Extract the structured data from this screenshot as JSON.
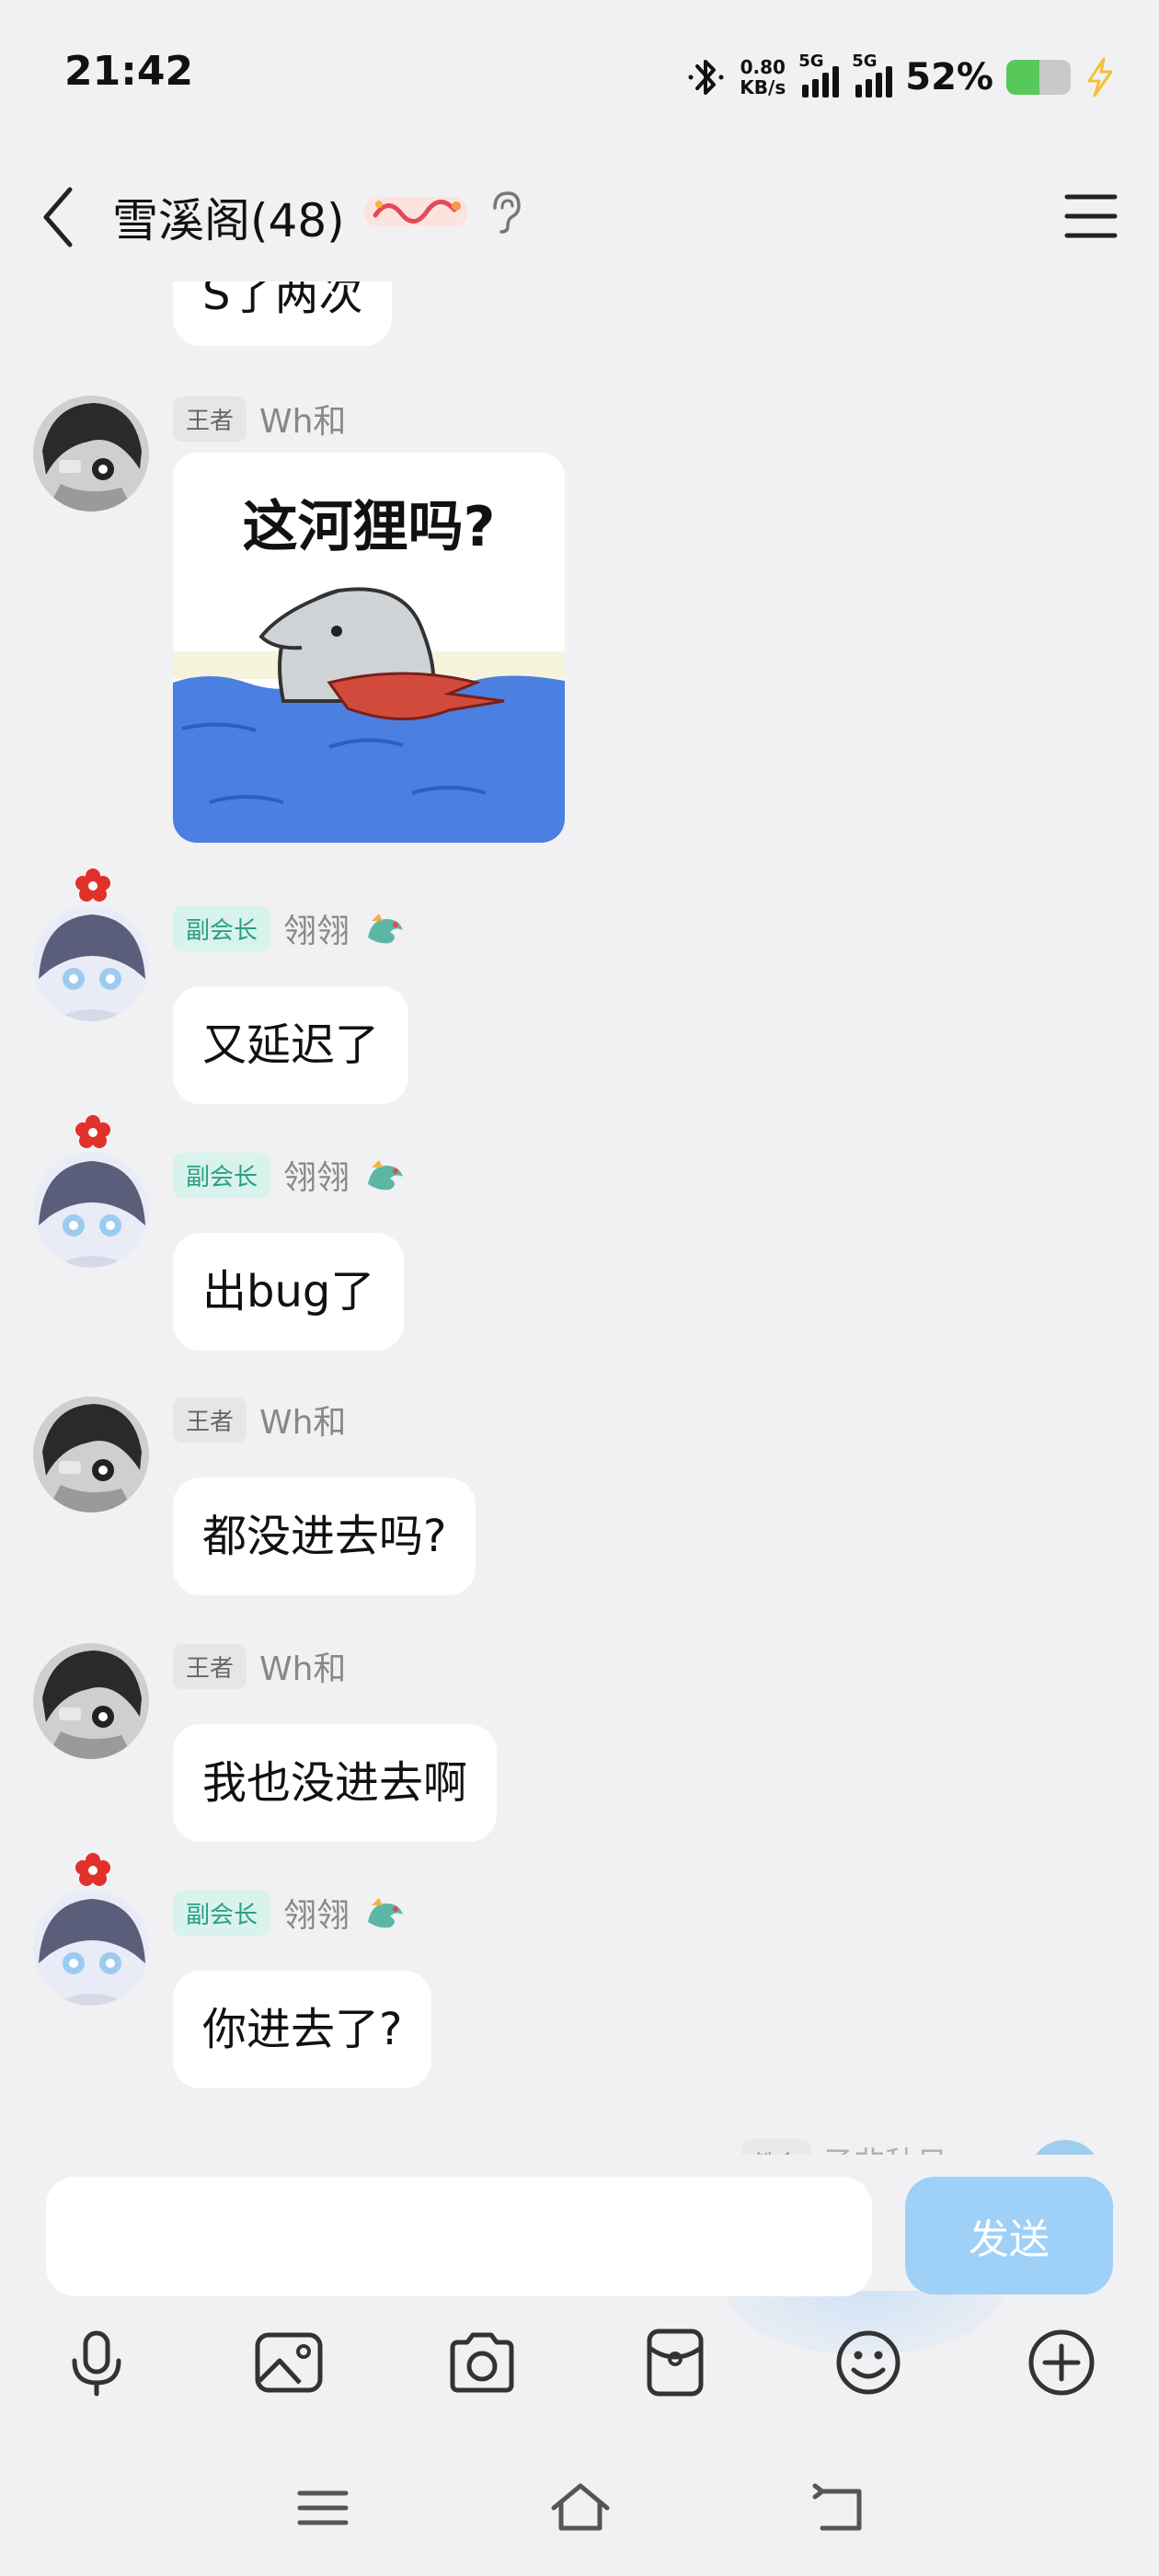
{
  "status": {
    "time": "21:42",
    "speed_value": "0.80",
    "speed_unit": "KB/s",
    "net1": "5G",
    "net2": "5G",
    "battery_pct": "52%"
  },
  "header": {
    "title": "雪溪阁(48)"
  },
  "messages": [
    {
      "role": "",
      "name": "",
      "text": "S了两次"
    },
    {
      "role": "王者",
      "name": "Wh和",
      "sticker_text": "这河狸吗?"
    },
    {
      "role": "副会长",
      "name": "翎翎",
      "text": "又延迟了"
    },
    {
      "role": "副会长",
      "name": "翎翎",
      "text": "出bug了"
    },
    {
      "role": "王者",
      "name": "Wh和",
      "text": "都没进去吗?"
    },
    {
      "role": "王者",
      "name": "Wh和",
      "text": "我也没进去啊"
    },
    {
      "role": "副会长",
      "name": "翎翎",
      "text": "你进去了?"
    }
  ],
  "partial_row": {
    "role": "铁会",
    "name": "孑非秋日"
  },
  "input": {
    "send_label": "发送",
    "value": ""
  },
  "colors": {
    "background": "#f1f1f3",
    "send": "#9fd0f7",
    "vp_badge": "#d8f2ec",
    "king_badge": "#e6e6e9"
  },
  "toolbar_icons": [
    "microphone-icon",
    "image-icon",
    "camera-icon",
    "red-packet-icon",
    "emoji-icon",
    "plus-icon"
  ],
  "nav_icons": [
    "menu-icon",
    "home-icon",
    "back-icon"
  ]
}
